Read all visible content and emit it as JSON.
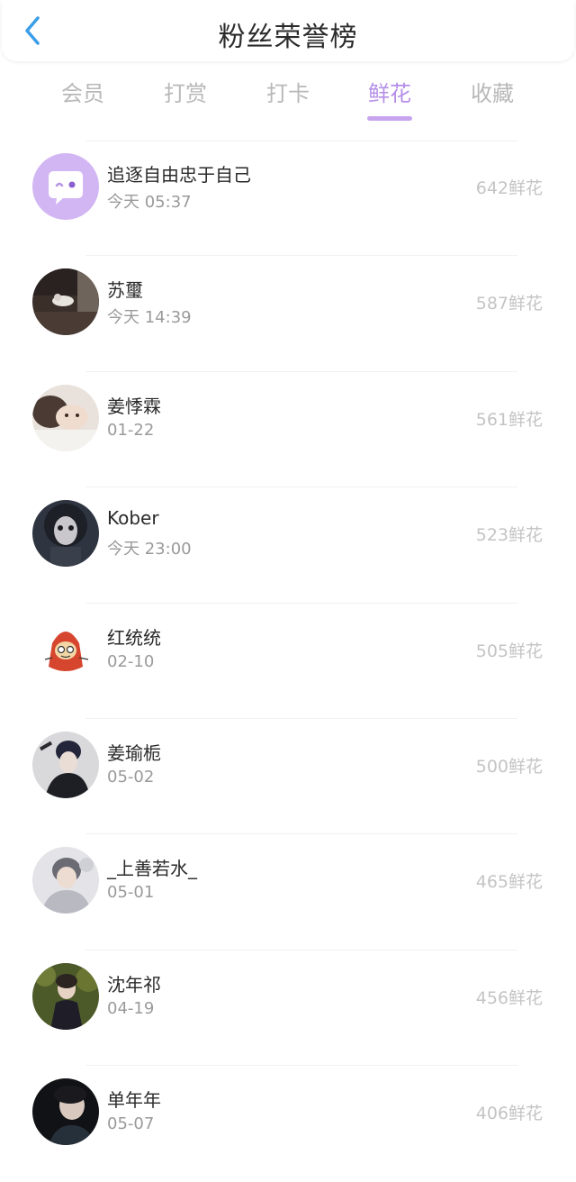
{
  "header": {
    "title": "粉丝荣誉榜",
    "back_icon": "chevron-left-icon",
    "accent_color": "#3a9ee8"
  },
  "tabs": [
    {
      "label": "会员",
      "active": false
    },
    {
      "label": "打赏",
      "active": false
    },
    {
      "label": "打卡",
      "active": false
    },
    {
      "label": "鲜花",
      "active": true
    },
    {
      "label": "收藏",
      "active": false
    }
  ],
  "colors": {
    "active_tab": "#b48ee8",
    "inactive_tab": "#b8b8b8",
    "count_text": "#c4c4c4"
  },
  "list": [
    {
      "name": "追逐自由忠于自己",
      "time": "今天 05:37",
      "count": "642鲜花",
      "avatar": "default-chat-avatar"
    },
    {
      "name": "苏璽",
      "time": "今天 14:39",
      "count": "587鲜花",
      "avatar": "photo-avatar"
    },
    {
      "name": "姜悸霖",
      "time": "01-22",
      "count": "561鲜花",
      "avatar": "photo-avatar"
    },
    {
      "name": "Kober",
      "time": "今天 23:00",
      "count": "523鲜花",
      "avatar": "photo-avatar"
    },
    {
      "name": "红统统",
      "time": "02-10",
      "count": "505鲜花",
      "avatar": "cartoon-avatar"
    },
    {
      "name": "姜瑜栀",
      "time": "05-02",
      "count": "500鲜花",
      "avatar": "photo-avatar"
    },
    {
      "name": "_上善若水_",
      "time": "05-01",
      "count": "465鲜花",
      "avatar": "photo-avatar"
    },
    {
      "name": "沈年祁",
      "time": "04-19",
      "count": "456鲜花",
      "avatar": "photo-avatar"
    },
    {
      "name": "单年年",
      "time": "05-07",
      "count": "406鲜花",
      "avatar": "photo-avatar"
    }
  ]
}
